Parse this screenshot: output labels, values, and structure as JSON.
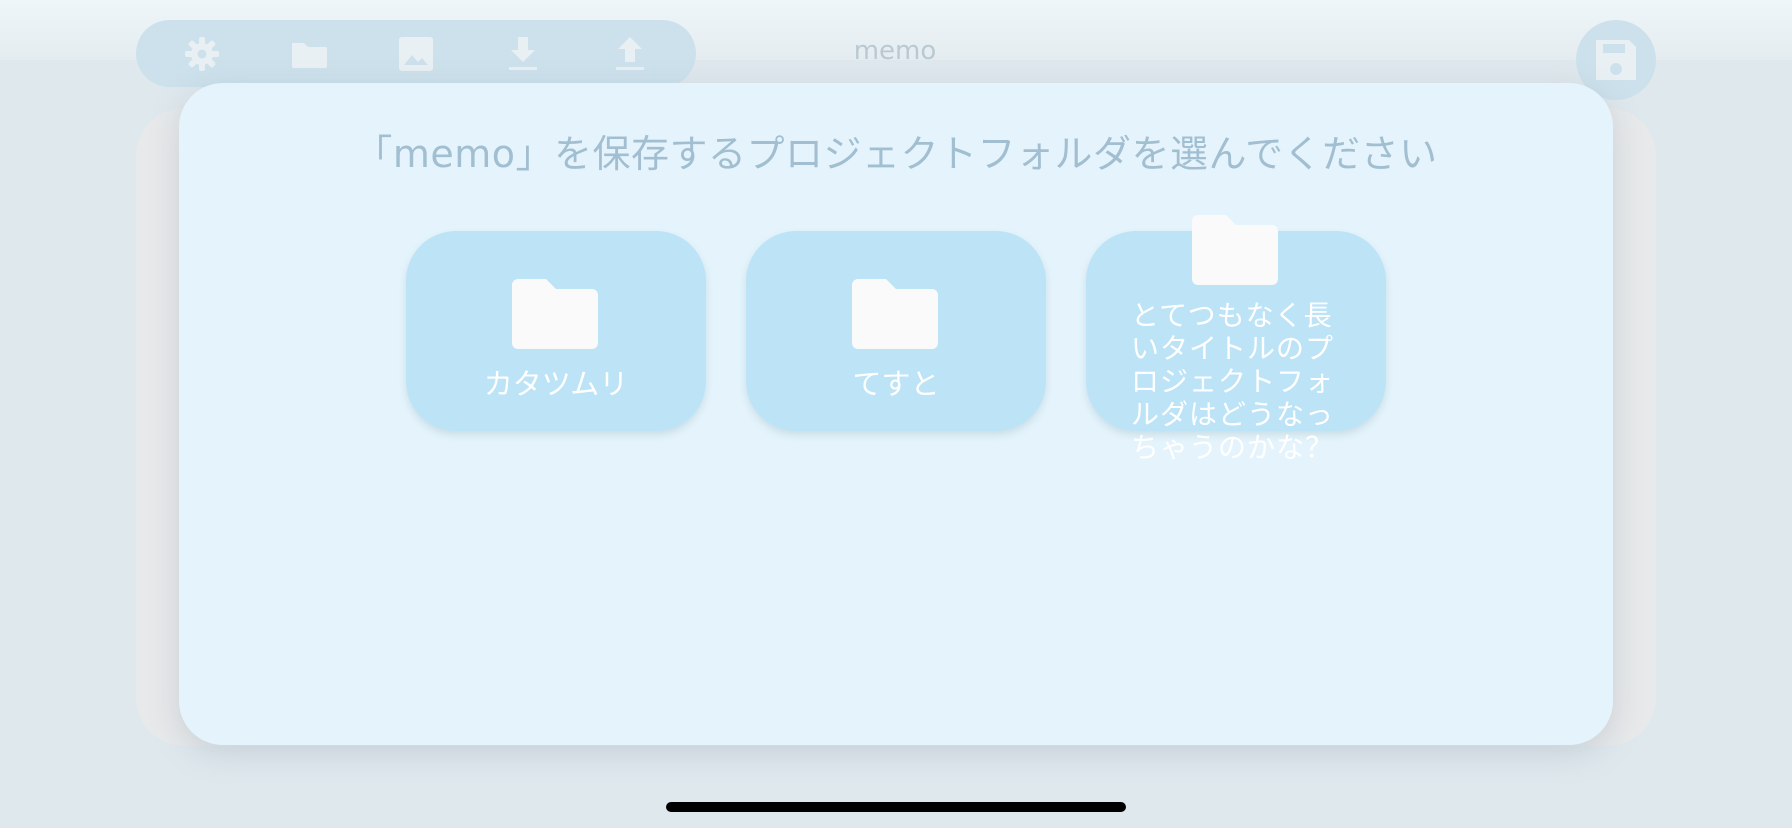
{
  "toolbar": {
    "icons": [
      "gear-icon",
      "folder-icon",
      "image-icon",
      "download-icon",
      "upload-icon"
    ]
  },
  "document": {
    "title": "memo",
    "save_icon": "floppy-disk-icon"
  },
  "modal": {
    "title": "「memo」を保存するプロジェクトフォルダを選んでください",
    "folders": [
      {
        "label": "カタツムリ",
        "icon": "folder-icon"
      },
      {
        "label": "てすと",
        "icon": "folder-icon"
      },
      {
        "label": "とてつもなく長いタイトルのプロジェクトフォルダはどうなっちゃうのかな？",
        "icon": "folder-icon"
      }
    ]
  },
  "colors": {
    "modal_bg": "#e5f4fc",
    "card_bg": "#bde3f7",
    "title_text": "#a2bfd1",
    "toolbar_bg": "#cde1ec"
  }
}
